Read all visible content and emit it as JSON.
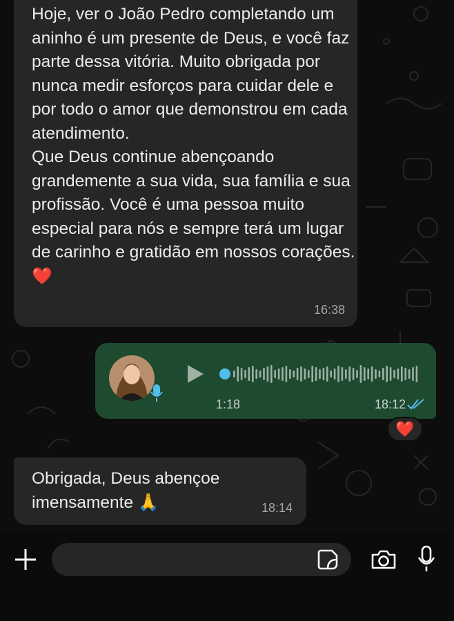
{
  "messages": [
    {
      "direction": "incoming",
      "paragraphs": [
        "Hoje, ver o João Pedro completando um aninho é um presente de Deus, e você faz parte dessa vitória. Muito obrigada por nunca medir esforços para cuidar dele e por todo o amor que demonstrou em cada atendimento.",
        "Que Deus continue abençoando grandemente a sua vida, sua família e sua profissão. Você é uma pessoa muito especial para nós e sempre terá um lugar de carinho e gratidão em nossos corações."
      ],
      "emoji": "❤️",
      "time": "16:38"
    },
    {
      "direction": "outgoing",
      "type": "voice",
      "duration": "1:18",
      "played_fraction": 0.0,
      "time": "18:12",
      "status": "read",
      "reaction": "❤️"
    },
    {
      "direction": "incoming",
      "text": "Obrigada, Deus abençoe imensamente",
      "emoji": "🙏",
      "time": "18:14"
    }
  ],
  "composer": {
    "placeholder": "",
    "icons": [
      "plus-icon",
      "sticker-icon",
      "camera-icon",
      "mic-icon"
    ]
  },
  "colors": {
    "incoming_bubble": "#262626",
    "outgoing_bubble": "#1e4a2f",
    "read_ticks": "#53bdeb",
    "heart": "#e0182d"
  }
}
